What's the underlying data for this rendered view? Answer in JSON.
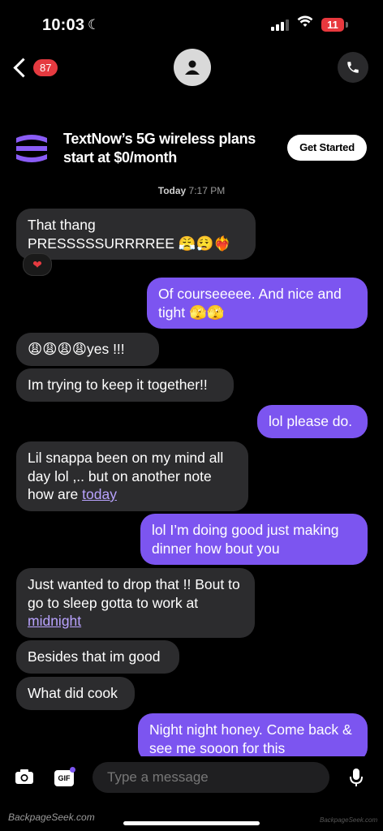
{
  "status_bar": {
    "time": "10:03",
    "battery": "11"
  },
  "header": {
    "badge_count": "87"
  },
  "ad": {
    "line1": "TextNow’s 5G wireless plans",
    "line2": "start at $0/month",
    "button": "Get Started"
  },
  "date_header": {
    "day": "Today",
    "time": "7:17 PM"
  },
  "messages": [
    {
      "dir": "in",
      "text": "That thang PRESSSSSURRRREE 😤😮‍💨❤️‍🔥",
      "reaction": "❤"
    },
    {
      "dir": "out",
      "text": "Of courseeeee. And nice and tight 🫣🫣"
    },
    {
      "dir": "in",
      "text": "😩😩😩😩yes !!!"
    },
    {
      "dir": "in",
      "text": "Im trying to keep it together!!"
    },
    {
      "dir": "out",
      "text": "lol please do."
    },
    {
      "dir": "in",
      "text": "Lil snappa been on my mind all day lol ,.. but on another note how are",
      "link": "today"
    },
    {
      "dir": "out",
      "text": "lol I’m doing good just making dinner how bout you"
    },
    {
      "dir": "in",
      "text": "Just wanted to drop that !! Bout to go to sleep gotta to work at",
      "link": "midnight"
    },
    {
      "dir": "in",
      "text": "Besides that im good"
    },
    {
      "dir": "in",
      "text": "What did cook"
    },
    {
      "dir": "out",
      "text": "Night night honey. Come back & see me sooon for this"
    }
  ],
  "composer": {
    "placeholder": "Type a message",
    "gif_label": "GIF"
  },
  "watermark": "BackpageSeek.com",
  "watermark_small": "BackpageSeek.com"
}
